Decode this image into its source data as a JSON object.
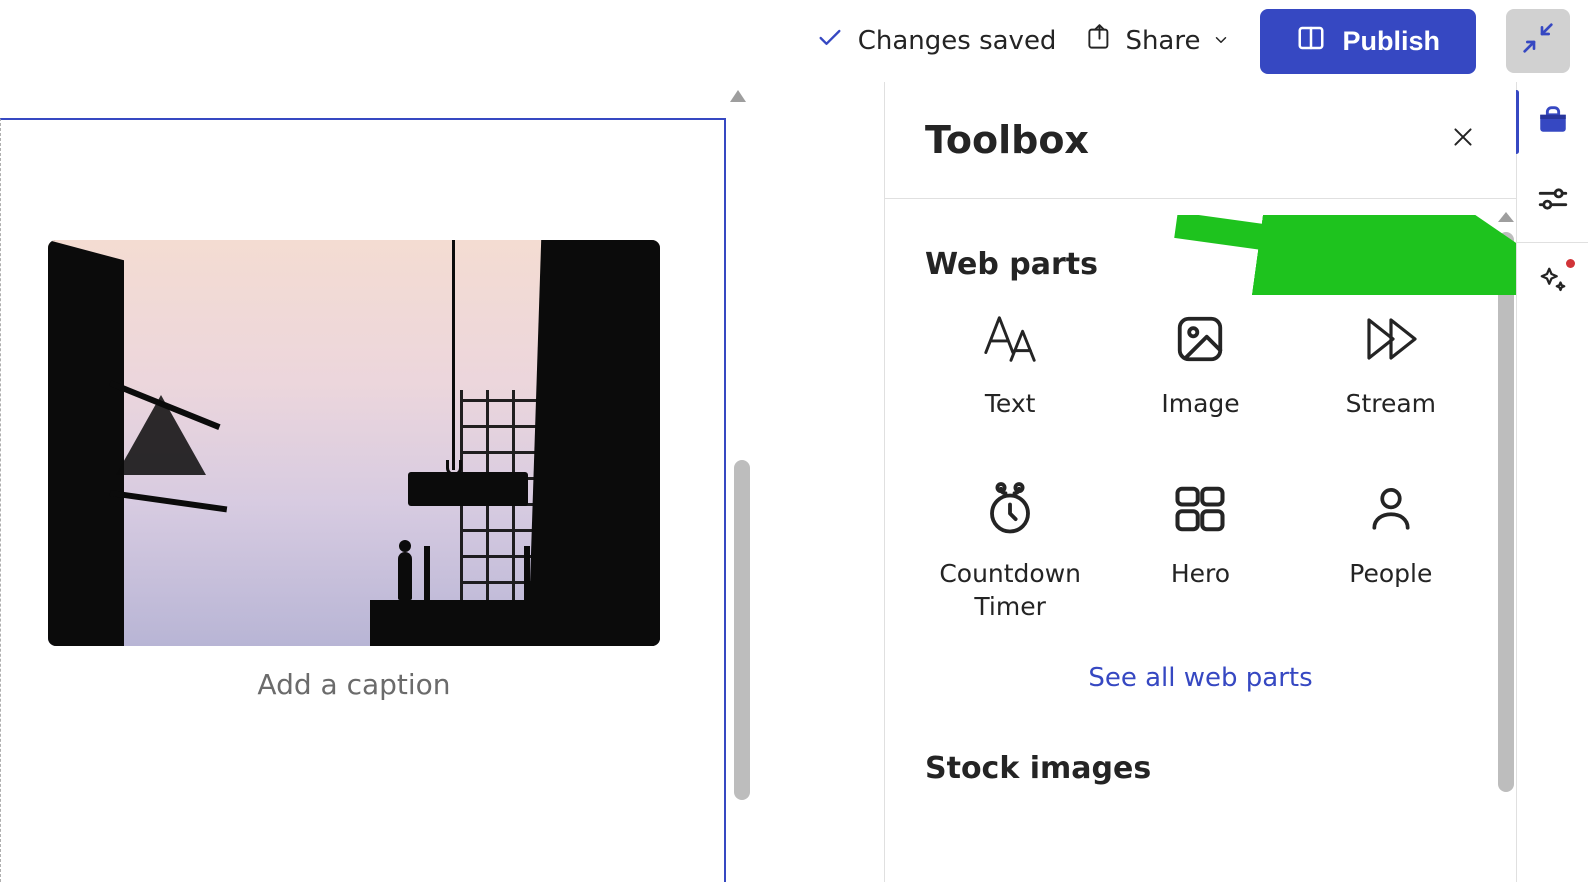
{
  "commandBar": {
    "status_label": "Changes saved",
    "share_label": "Share",
    "publish_label": "Publish"
  },
  "rail": {
    "items": [
      {
        "id": "toolbox",
        "icon": "toolbox-icon",
        "selected": true,
        "dot": false
      },
      {
        "id": "settings",
        "icon": "sliders-icon",
        "selected": false,
        "dot": false
      },
      {
        "id": "ai",
        "icon": "sparkle-icon",
        "selected": false,
        "dot": true
      }
    ]
  },
  "panel": {
    "title": "Toolbox",
    "sections": {
      "webparts": {
        "heading": "Web parts",
        "items": [
          {
            "id": "text",
            "label": "Text",
            "icon": "text-aa-icon"
          },
          {
            "id": "image",
            "label": "Image",
            "icon": "image-icon"
          },
          {
            "id": "stream",
            "label": "Stream",
            "icon": "stream-icon"
          },
          {
            "id": "timer",
            "label": "Countdown Timer",
            "icon": "timer-icon"
          },
          {
            "id": "hero",
            "label": "Hero",
            "icon": "hero-icon"
          },
          {
            "id": "people",
            "label": "People",
            "icon": "people-icon"
          }
        ],
        "see_all_label": "See all web parts"
      },
      "stock": {
        "heading": "Stock images"
      }
    }
  },
  "canvas": {
    "image_webpart": {
      "caption_placeholder": "Add a caption"
    }
  }
}
